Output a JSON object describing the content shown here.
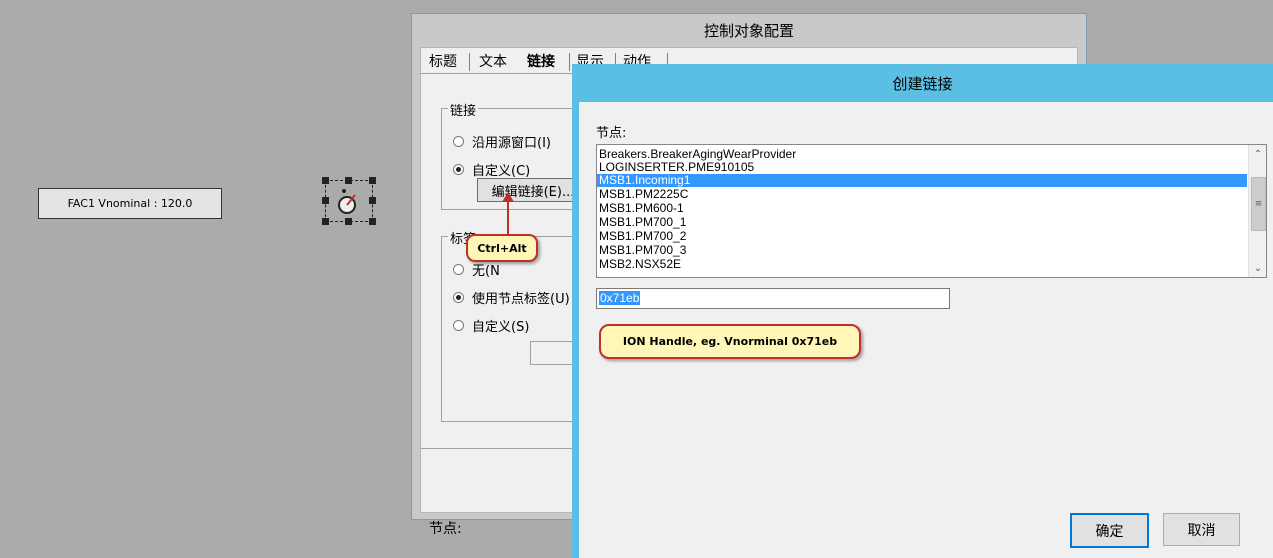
{
  "canvas": {
    "fac_label": "FAC1 Vnominal : 120.0",
    "gauge_icon": "gauge-icon"
  },
  "config_dialog": {
    "title": "控制对象配置",
    "tabs": [
      "标题",
      "文本",
      "链接",
      "显示",
      "动作"
    ],
    "link_group": {
      "title": "链接",
      "option_source": "沿用源窗口(I)",
      "option_custom": "自定义(C)",
      "edit_button": "编辑链接(E)..."
    },
    "label_group": {
      "title": "标签",
      "option_none": "无(N",
      "option_node_label": "使用节点标签(U)",
      "option_custom": "自定义(S)"
    },
    "footer_node_label": "节点:"
  },
  "callouts": {
    "ctrl_alt": "Ctrl+Alt",
    "ion_handle": "ION Handle, eg. Vnorminal  0x71eb"
  },
  "link_dialog": {
    "title": "创建链接",
    "node_caption": "节点:",
    "nodes": [
      "Breakers.BreakerAgingWearProvider",
      "LOGINSERTER.PME910105",
      "MSB1.Incoming1",
      "MSB1.PM2225C",
      "MSB1.PM600-1",
      "MSB1.PM700_1",
      "MSB1.PM700_2",
      "MSB1.PM700_3",
      "MSB2.NSX52E"
    ],
    "selected_node": "MSB1.Incoming1",
    "handle_value": "0x71eb",
    "ok_label": "确定",
    "cancel_label": "取消"
  }
}
